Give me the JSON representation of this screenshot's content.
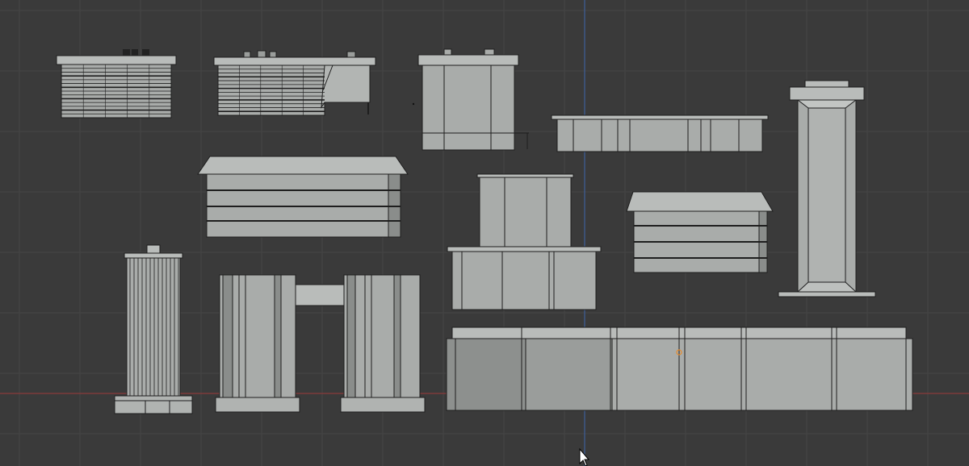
{
  "viewport": {
    "background": "#3a3a3a",
    "grid_color": "#454545",
    "x_axis_color": "#8a3a3a",
    "y_axis_color": "#3d5f99",
    "object_fill": "#a9acaa",
    "object_fill_light": "#b9bcba",
    "object_fill_dark": "#8a8d8b",
    "object_stroke": "#1e1e1e",
    "origin_color": "#e88a2a"
  },
  "scene": {
    "objects": [
      "roof-ac-unit-small",
      "roof-ac-unit-with-duct",
      "roof-box-with-vents",
      "long-low-trough",
      "tall-chimney-pillar",
      "large-flat-roof-box",
      "stacked-box-tower",
      "medium-flat-roof-box",
      "cylindrical-tank",
      "twin-pillar-gate",
      "long-wall-segment"
    ]
  },
  "cursor": {
    "icon": "arrow-cursor-icon"
  }
}
